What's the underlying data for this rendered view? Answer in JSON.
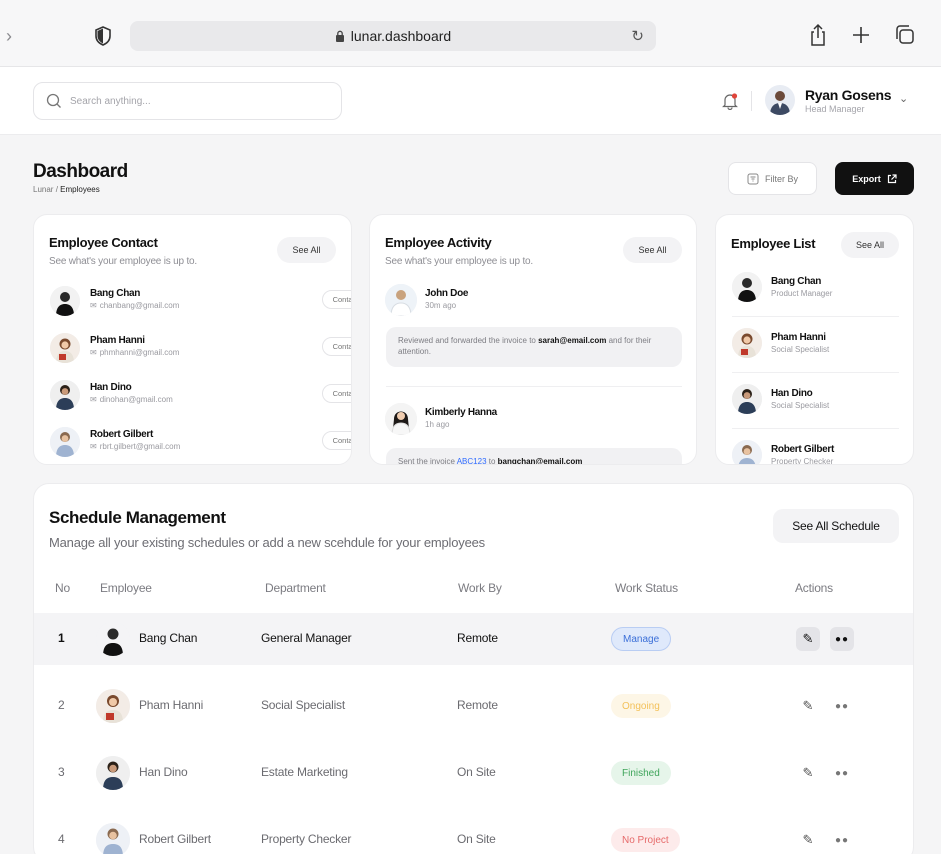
{
  "browser": {
    "url": "lunar.dashboard"
  },
  "topbar": {
    "search_placeholder": "Search anything...",
    "user_name": "Ryan Gosens",
    "user_role": "Head Manager"
  },
  "header": {
    "title": "Dashboard",
    "breadcrumb_root": "Lunar",
    "breadcrumb_sep": "/",
    "breadcrumb_current": "Employees",
    "filter_label": "Filter By",
    "export_label": "Export"
  },
  "contact_card": {
    "title": "Employee Contact",
    "subtitle": "See what's your employee is up to.",
    "see_all": "See All",
    "contact_label": "Contact",
    "items": [
      {
        "name": "Bang Chan",
        "email": "chanbang@gmail.com"
      },
      {
        "name": "Pham Hanni",
        "email": "phmhanni@gmail.com"
      },
      {
        "name": "Han Dino",
        "email": "dinohan@gmail.com"
      },
      {
        "name": "Robert Gilbert",
        "email": "rbrt.gilbert@gmail.com"
      }
    ]
  },
  "activity_card": {
    "title": "Employee Activity",
    "subtitle": "See what's your employee is up to.",
    "see_all": "See All",
    "items": [
      {
        "name": "John Doe",
        "time": "30m ago",
        "msg_pre": "Reviewed and forwarded the invoice to ",
        "msg_bold": "sarah@email.com",
        "msg_post": " and  for their attention."
      },
      {
        "name": "Kimberly Hanna",
        "time": "1h ago",
        "msg_pre": "Sent the invoice ",
        "msg_link": "ABC123",
        "msg_mid": " to ",
        "msg_bold": "bangchan@email.com"
      }
    ]
  },
  "list_card": {
    "title": "Employee List",
    "see_all": "See All",
    "items": [
      {
        "name": "Bang Chan",
        "role": "Product Manager"
      },
      {
        "name": "Pham Hanni",
        "role": "Social Specialist"
      },
      {
        "name": "Han Dino",
        "role": "Social Specialist"
      },
      {
        "name": "Robert Gilbert",
        "role": "Property Checker"
      }
    ]
  },
  "schedule": {
    "title": "Schedule Management",
    "subtitle": "Manage all your existing schedules or add a new scehdule for your employees",
    "see_all_label": "See All Schedule",
    "columns": {
      "no": "No",
      "employee": "Employee",
      "department": "Department",
      "work_by": "Work By",
      "status": "Work Status",
      "actions": "Actions"
    },
    "rows": [
      {
        "no": "1",
        "employee": "Bang Chan",
        "department": "General Manager",
        "work_by": "Remote",
        "status": "Manage",
        "status_color": "#3b6fd8",
        "status_bg": "#dfe9fb"
      },
      {
        "no": "2",
        "employee": "Pham Hanni",
        "department": "Social Specialist",
        "work_by": "Remote",
        "status": "Ongoing",
        "status_color": "#f3c15a",
        "status_bg": "#fdf6e6"
      },
      {
        "no": "3",
        "employee": "Han Dino",
        "department": "Estate Marketing",
        "work_by": "On Site",
        "status": "Finished",
        "status_color": "#3fa55b",
        "status_bg": "#e6f5ea"
      },
      {
        "no": "4",
        "employee": "Robert Gilbert",
        "department": "Property Checker",
        "work_by": "On Site",
        "status": "No Project",
        "status_color": "#e66a6a",
        "status_bg": "#fdebeb"
      }
    ]
  },
  "colors": {
    "accent_dark": "#111111",
    "link": "#2f6bff",
    "notification_dot": "#e0453b"
  },
  "icons": [
    "back-chevron-icon",
    "shield-icon",
    "lock-icon",
    "reload-icon",
    "share-icon",
    "plus-icon",
    "tabs-icon",
    "search-icon",
    "bell-icon",
    "chevron-down-icon",
    "filter-icon",
    "external-link-icon",
    "mail-icon",
    "edit-icon",
    "more-icon"
  ]
}
